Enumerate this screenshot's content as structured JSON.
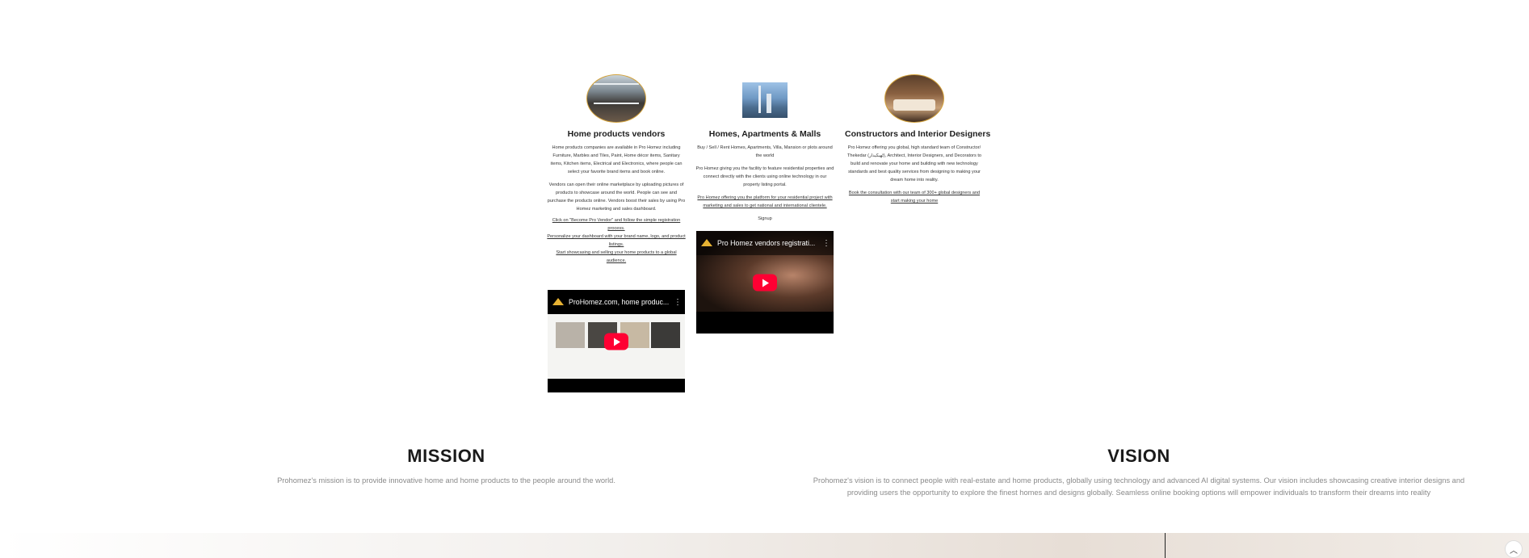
{
  "services": [
    {
      "image_icon": "interior-living-room-photo",
      "title": "Home products vendors",
      "p1": "Home products companies are available in Pro Homez including Furniture, Marbles and Tiles, Paint, Home décor items, Sanitary items, Kitchen items, Electrical and Electronics, where people can select your favorite brand items and book online.",
      "p2": "Vendors can open their online marketplace by uploading pictures of products to showcase around the world. People can see and purchase the products online. Vendors boost their sales by using Pro Homez marketing and sales dashboard.",
      "step1": "Click on \"Become Pro Vendor\" and follow the simple registration process.",
      "step2": "Personalize your dashboard with your brand name, logo, and product listings.",
      "step3": "Start showcasing and selling your home products to a global audience."
    },
    {
      "image_icon": "city-skyline-photo",
      "title": "Homes, Apartments & Malls",
      "p1": "Buy / Sell / Rent Homes, Apartments, Villa, Mansion or plots around the world",
      "p2": "Pro Homez giving you the facility to feature residential properties and connect directly with the clients using online technology in our property listing portal.",
      "p3": "Pro Homez offering you the platform for your residential project with marketing and sales to get national and international clientele.",
      "signup": "Signup"
    },
    {
      "image_icon": "bedroom-interior-photo",
      "title": "Constructors and Interior Designers",
      "p1": "Pro Homez offering you global, high standard team of Constructor/ Thekedar (ٹھیکیدار), Architect, Interior Designers, and Decorators to build and renovate your home and building with new technology standards and best quality services from designing to making your dream home into reality.",
      "p2": "Book the consultation with our team of 300+ global designers and start making your home"
    }
  ],
  "videos": [
    {
      "title": "ProHomez.com, home produc...",
      "logo_icon": "prohomez-logo-icon",
      "play_icon": "youtube-play-icon",
      "menu_icon": "kebab-menu-icon"
    },
    {
      "title": "Pro Homez vendors registrati...",
      "logo_icon": "prohomez-logo-icon",
      "play_icon": "youtube-play-icon",
      "menu_icon": "kebab-menu-icon"
    }
  ],
  "mission": {
    "heading": "MISSION",
    "text": "Prohomez's mission is to provide innovative home and home products to the people around the world."
  },
  "vision": {
    "heading": "VISION",
    "text": "Prohomez's vision is to connect people with real-estate and home products, globally using technology and advanced AI digital systems. Our vision includes showcasing creative interior designs and providing users the opportunity to explore the finest homes and designs globally. Seamless online booking options will empower individuals to transform their dreams into reality"
  },
  "scroll_top_icon": "chevron-up-icon",
  "colors": {
    "accent_gold": "#d4a33c",
    "youtube_red": "#ff0033",
    "muted_text": "#8a8a8a"
  }
}
